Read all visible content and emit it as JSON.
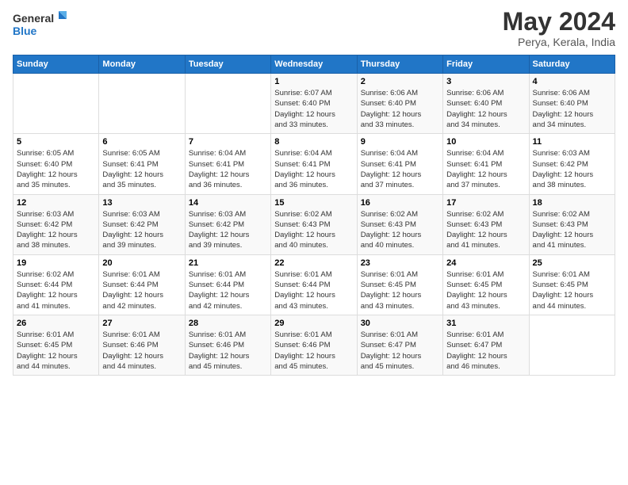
{
  "logo": {
    "line1": "General",
    "line2": "Blue"
  },
  "header": {
    "title": "May 2024",
    "location": "Perya, Kerala, India"
  },
  "weekdays": [
    "Sunday",
    "Monday",
    "Tuesday",
    "Wednesday",
    "Thursday",
    "Friday",
    "Saturday"
  ],
  "weeks": [
    [
      {
        "day": "",
        "info": ""
      },
      {
        "day": "",
        "info": ""
      },
      {
        "day": "",
        "info": ""
      },
      {
        "day": "1",
        "info": "Sunrise: 6:07 AM\nSunset: 6:40 PM\nDaylight: 12 hours\nand 33 minutes."
      },
      {
        "day": "2",
        "info": "Sunrise: 6:06 AM\nSunset: 6:40 PM\nDaylight: 12 hours\nand 33 minutes."
      },
      {
        "day": "3",
        "info": "Sunrise: 6:06 AM\nSunset: 6:40 PM\nDaylight: 12 hours\nand 34 minutes."
      },
      {
        "day": "4",
        "info": "Sunrise: 6:06 AM\nSunset: 6:40 PM\nDaylight: 12 hours\nand 34 minutes."
      }
    ],
    [
      {
        "day": "5",
        "info": "Sunrise: 6:05 AM\nSunset: 6:40 PM\nDaylight: 12 hours\nand 35 minutes."
      },
      {
        "day": "6",
        "info": "Sunrise: 6:05 AM\nSunset: 6:41 PM\nDaylight: 12 hours\nand 35 minutes."
      },
      {
        "day": "7",
        "info": "Sunrise: 6:04 AM\nSunset: 6:41 PM\nDaylight: 12 hours\nand 36 minutes."
      },
      {
        "day": "8",
        "info": "Sunrise: 6:04 AM\nSunset: 6:41 PM\nDaylight: 12 hours\nand 36 minutes."
      },
      {
        "day": "9",
        "info": "Sunrise: 6:04 AM\nSunset: 6:41 PM\nDaylight: 12 hours\nand 37 minutes."
      },
      {
        "day": "10",
        "info": "Sunrise: 6:04 AM\nSunset: 6:41 PM\nDaylight: 12 hours\nand 37 minutes."
      },
      {
        "day": "11",
        "info": "Sunrise: 6:03 AM\nSunset: 6:42 PM\nDaylight: 12 hours\nand 38 minutes."
      }
    ],
    [
      {
        "day": "12",
        "info": "Sunrise: 6:03 AM\nSunset: 6:42 PM\nDaylight: 12 hours\nand 38 minutes."
      },
      {
        "day": "13",
        "info": "Sunrise: 6:03 AM\nSunset: 6:42 PM\nDaylight: 12 hours\nand 39 minutes."
      },
      {
        "day": "14",
        "info": "Sunrise: 6:03 AM\nSunset: 6:42 PM\nDaylight: 12 hours\nand 39 minutes."
      },
      {
        "day": "15",
        "info": "Sunrise: 6:02 AM\nSunset: 6:43 PM\nDaylight: 12 hours\nand 40 minutes."
      },
      {
        "day": "16",
        "info": "Sunrise: 6:02 AM\nSunset: 6:43 PM\nDaylight: 12 hours\nand 40 minutes."
      },
      {
        "day": "17",
        "info": "Sunrise: 6:02 AM\nSunset: 6:43 PM\nDaylight: 12 hours\nand 41 minutes."
      },
      {
        "day": "18",
        "info": "Sunrise: 6:02 AM\nSunset: 6:43 PM\nDaylight: 12 hours\nand 41 minutes."
      }
    ],
    [
      {
        "day": "19",
        "info": "Sunrise: 6:02 AM\nSunset: 6:44 PM\nDaylight: 12 hours\nand 41 minutes."
      },
      {
        "day": "20",
        "info": "Sunrise: 6:01 AM\nSunset: 6:44 PM\nDaylight: 12 hours\nand 42 minutes."
      },
      {
        "day": "21",
        "info": "Sunrise: 6:01 AM\nSunset: 6:44 PM\nDaylight: 12 hours\nand 42 minutes."
      },
      {
        "day": "22",
        "info": "Sunrise: 6:01 AM\nSunset: 6:44 PM\nDaylight: 12 hours\nand 43 minutes."
      },
      {
        "day": "23",
        "info": "Sunrise: 6:01 AM\nSunset: 6:45 PM\nDaylight: 12 hours\nand 43 minutes."
      },
      {
        "day": "24",
        "info": "Sunrise: 6:01 AM\nSunset: 6:45 PM\nDaylight: 12 hours\nand 43 minutes."
      },
      {
        "day": "25",
        "info": "Sunrise: 6:01 AM\nSunset: 6:45 PM\nDaylight: 12 hours\nand 44 minutes."
      }
    ],
    [
      {
        "day": "26",
        "info": "Sunrise: 6:01 AM\nSunset: 6:45 PM\nDaylight: 12 hours\nand 44 minutes."
      },
      {
        "day": "27",
        "info": "Sunrise: 6:01 AM\nSunset: 6:46 PM\nDaylight: 12 hours\nand 44 minutes."
      },
      {
        "day": "28",
        "info": "Sunrise: 6:01 AM\nSunset: 6:46 PM\nDaylight: 12 hours\nand 45 minutes."
      },
      {
        "day": "29",
        "info": "Sunrise: 6:01 AM\nSunset: 6:46 PM\nDaylight: 12 hours\nand 45 minutes."
      },
      {
        "day": "30",
        "info": "Sunrise: 6:01 AM\nSunset: 6:47 PM\nDaylight: 12 hours\nand 45 minutes."
      },
      {
        "day": "31",
        "info": "Sunrise: 6:01 AM\nSunset: 6:47 PM\nDaylight: 12 hours\nand 46 minutes."
      },
      {
        "day": "",
        "info": ""
      }
    ]
  ]
}
